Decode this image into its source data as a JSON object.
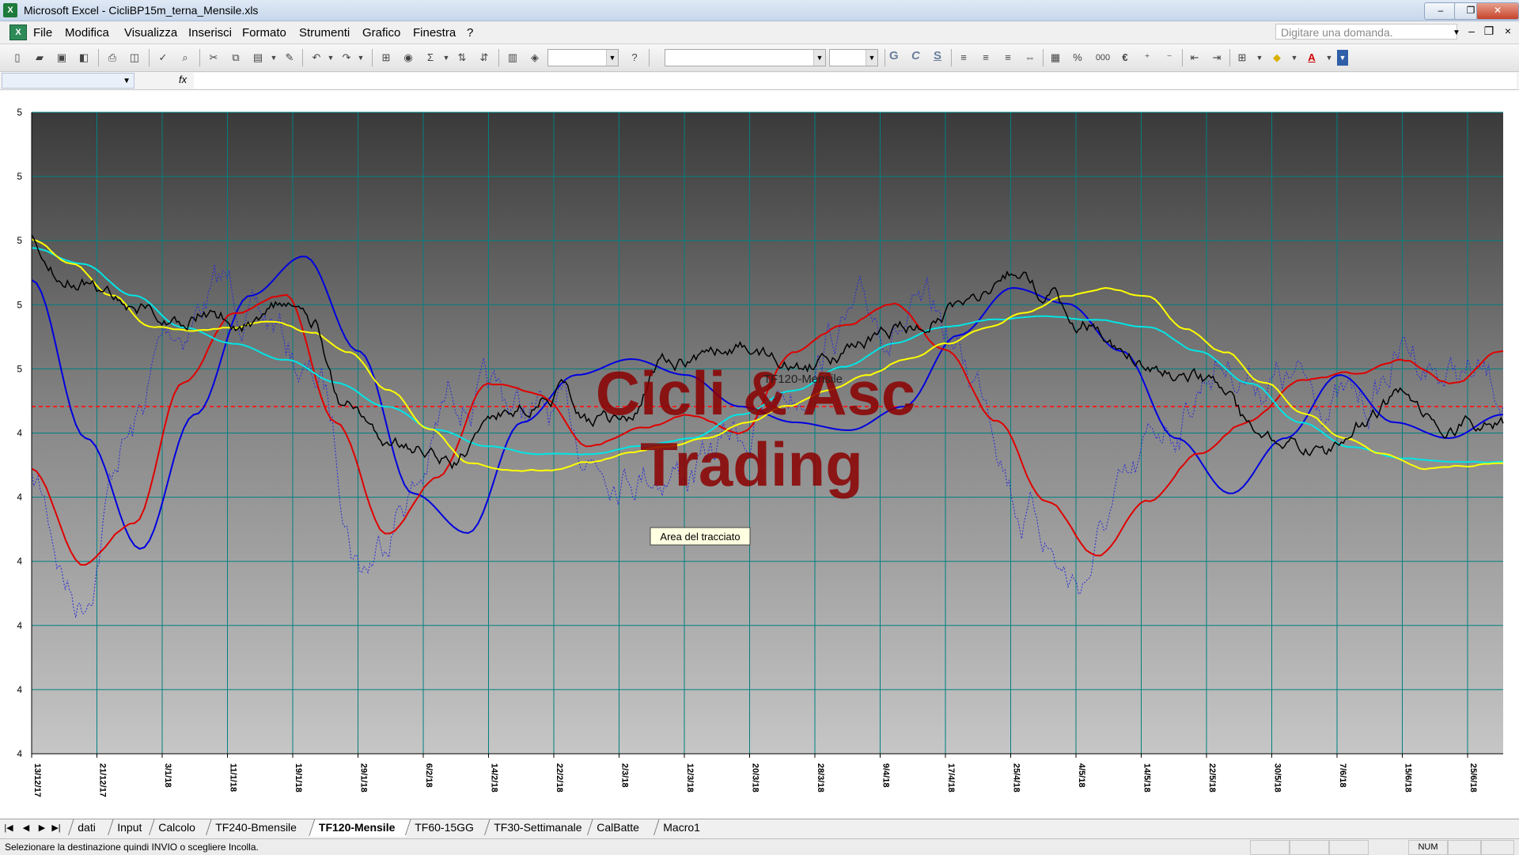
{
  "window": {
    "app_icon": "excel-icon",
    "title": "Microsoft Excel - CicliBP15m_terna_Mensile.xls",
    "minimize_glyph": "‒",
    "restore_glyph": "❐",
    "close_glyph": "✕"
  },
  "menubar": {
    "items": [
      "File",
      "Modifica",
      "Visualizza",
      "Inserisci",
      "Formato",
      "Strumenti",
      "Grafico",
      "Finestra",
      "?"
    ],
    "ask_placeholder": "Digitare una domanda.",
    "doc_close_glyph": "×"
  },
  "toolbar": {
    "format_buttons": [
      "G",
      "C",
      "S"
    ],
    "currency_glyph": "€",
    "percent_glyph": "%",
    "thousands_glyph": "000"
  },
  "chart": {
    "overlay_title": "TF120-Mensile",
    "watermark_line1": "Cicli & Asc",
    "watermark_line2": "Trading",
    "tooltip": "Area del tracciato",
    "y_ticks": [
      "5",
      "5",
      "5",
      "5",
      "5",
      "4",
      "4",
      "4",
      "4",
      "4"
    ],
    "x_ticks": [
      "13/12/17",
      "21/12/17",
      "3/1/18",
      "11/1/18",
      "19/1/18",
      "29/1/18",
      "6/2/18",
      "14/2/18",
      "22/2/18",
      "2/3/18",
      "12/3/18",
      "20/3/18",
      "28/3/18",
      "9/4/18",
      "17/4/18",
      "25/4/18",
      "4/5/18",
      "14/5/18",
      "22/5/18",
      "30/5/18",
      "7/6/18",
      "15/6/18",
      "25/6/18"
    ],
    "colors": {
      "price": "#000000",
      "fast_avg": "#ffff00",
      "slow_avg": "#00e5e5",
      "red_cycle": "#e00000",
      "blue_cycle": "#0000e0",
      "dotted_osc": "#2a2ad8",
      "ref_line": "#ff2020",
      "grid": "#008080",
      "watermark": "#8b0000"
    }
  },
  "chart_data": {
    "type": "line",
    "title": "TF120-Mensile",
    "x": [
      "13/12/17",
      "21/12/17",
      "3/1/18",
      "11/1/18",
      "19/1/18",
      "29/1/18",
      "6/2/18",
      "14/2/18",
      "22/2/18",
      "2/3/18",
      "12/3/18",
      "20/3/18",
      "28/3/18",
      "9/4/18",
      "17/4/18",
      "25/4/18",
      "4/5/18",
      "14/5/18",
      "22/5/18",
      "30/5/18",
      "7/6/18",
      "15/6/18",
      "25/6/18"
    ],
    "y_tick_labels": [
      "5",
      "5",
      "5",
      "5",
      "5",
      "4",
      "4",
      "4",
      "4",
      "4"
    ],
    "grid": true,
    "reference_line": "dashed red horizontal",
    "series": [
      {
        "color": "#000000",
        "style": "solid"
      },
      {
        "color": "#ffff00",
        "style": "solid"
      },
      {
        "color": "#00e5e5",
        "style": "solid"
      },
      {
        "color": "#e00000",
        "style": "solid"
      },
      {
        "color": "#0000e0",
        "style": "solid"
      },
      {
        "color": "#2a2ad8",
        "style": "dotted"
      }
    ]
  },
  "sheets": {
    "tabs": [
      "dati",
      "Input",
      "Calcolo",
      "TF240-Bmensile",
      "TF120-Mensile",
      "TF60-15GG",
      "TF30-Settimanale",
      "CalBatte",
      "Macro1"
    ],
    "active": "TF120-Mensile"
  },
  "statusbar": {
    "message": "Selezionare la destinazione quindi INVIO o scegliere Incolla.",
    "num": "NUM"
  }
}
